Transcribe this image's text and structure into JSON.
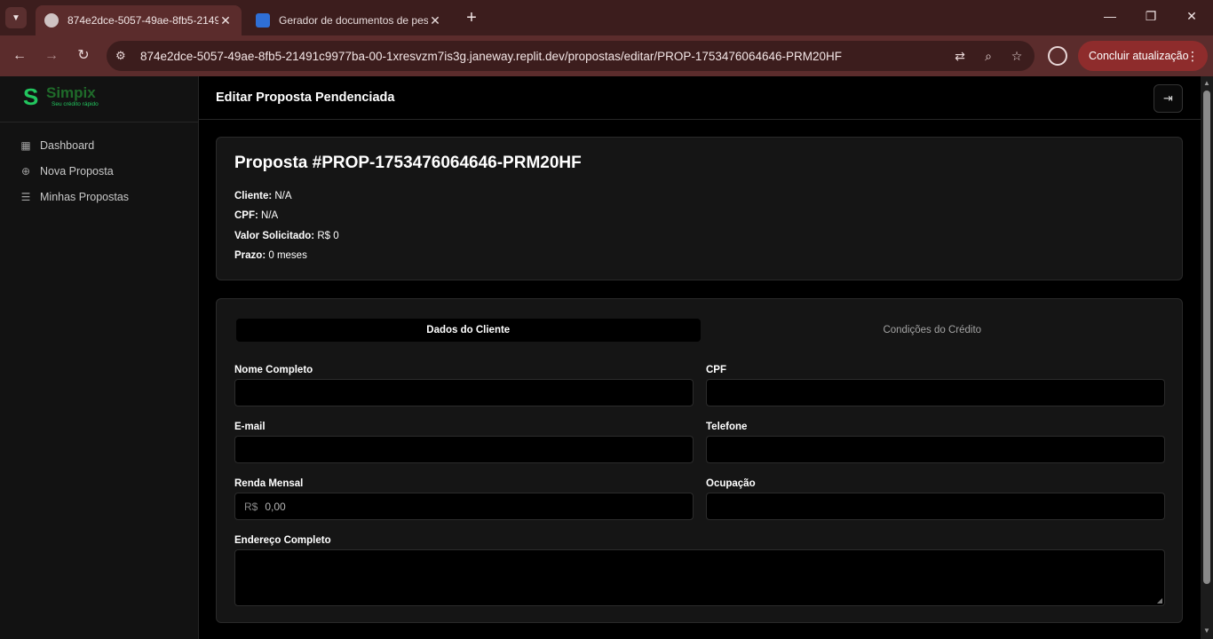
{
  "browser": {
    "active_tab_title": "874e2dce-5057-49ae-8fb5-2149",
    "inactive_tab_title": "Gerador de documentos de pes",
    "close_glyph": "✕",
    "new_tab_glyph": "+",
    "url": "874e2dce-5057-49ae-8fb5-21491c9977ba-00-1xresvzm7is3g.janeway.replit.dev/propostas/editar/PROP-1753476064646-PRM20HF",
    "update_button": "Concluir atualização",
    "colors": {
      "frame": "#3c1d1d",
      "toolbar": "#5b2c2c",
      "update": "#8e2c2c"
    }
  },
  "app": {
    "logo": {
      "name": "Simpix",
      "tagline": "Seu crédito rápido",
      "color": "#22c55e"
    },
    "sidebar": {
      "items": [
        {
          "label": "Dashboard",
          "icon": "grid-icon"
        },
        {
          "label": "Nova Proposta",
          "icon": "plus-circle-icon"
        },
        {
          "label": "Minhas Propostas",
          "icon": "list-icon"
        }
      ]
    },
    "header": {
      "title": "Editar Proposta Pendenciada"
    },
    "proposal": {
      "title": "Proposta #PROP-1753476064646-PRM20HF",
      "cliente_label": "Cliente:",
      "cliente_value": "N/A",
      "cpf_label": "CPF:",
      "cpf_value": "N/A",
      "valor_label": "Valor Solicitado:",
      "valor_value": "R$ 0",
      "prazo_label": "Prazo:",
      "prazo_value": "0 meses"
    },
    "tabs": [
      {
        "label": "Dados do Cliente",
        "active": true
      },
      {
        "label": "Condições do Crédito",
        "active": false
      }
    ],
    "form": {
      "nome_label": "Nome Completo",
      "cpf_label": "CPF",
      "email_label": "E-mail",
      "telefone_label": "Telefone",
      "renda_label": "Renda Mensal",
      "renda_prefix": "R$",
      "renda_placeholder": "0,00",
      "ocupacao_label": "Ocupação",
      "endereco_label": "Endereço Completo"
    }
  }
}
